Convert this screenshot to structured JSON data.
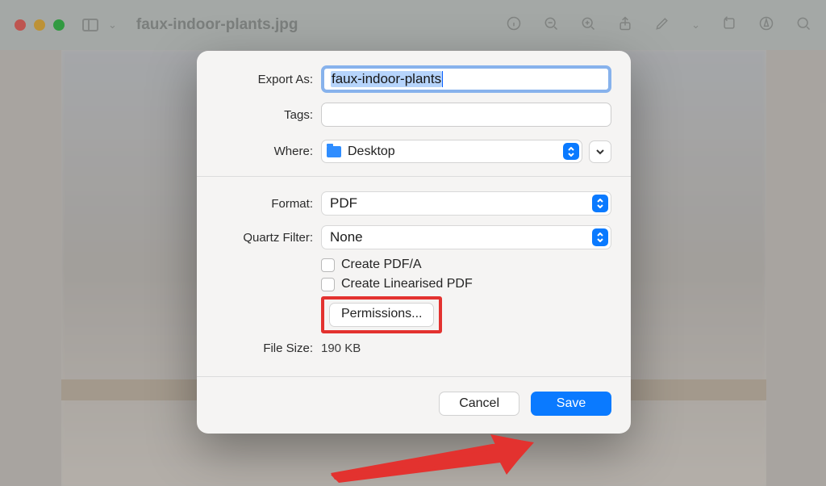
{
  "toolbar": {
    "title": "faux-indoor-plants.jpg"
  },
  "dialog": {
    "export_as_label": "Export As:",
    "export_as_value": "faux-indoor-plants",
    "tags_label": "Tags:",
    "tags_value": "",
    "where_label": "Where:",
    "where_value": "Desktop",
    "format_label": "Format:",
    "format_value": "PDF",
    "quartz_label": "Quartz Filter:",
    "quartz_value": "None",
    "pdfa_label": "Create PDF/A",
    "linearised_label": "Create Linearised PDF",
    "permissions_label": "Permissions...",
    "filesize_label": "File Size:",
    "filesize_value": "190 KB",
    "cancel_label": "Cancel",
    "save_label": "Save"
  }
}
